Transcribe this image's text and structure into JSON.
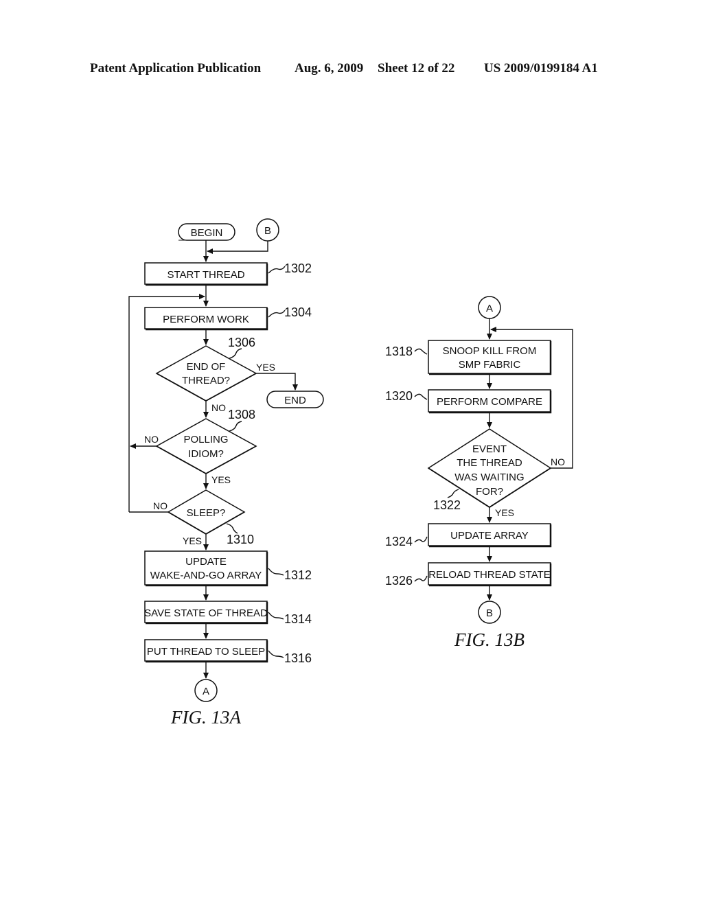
{
  "header": {
    "publication": "Patent Application Publication",
    "date": "Aug. 6, 2009",
    "sheet": "Sheet 12 of 22",
    "number": "US 2009/0199184 A1"
  },
  "fig13a": {
    "caption": "FIG. 13A",
    "begin": "BEGIN",
    "connector_in": "B",
    "connector_out": "A",
    "end": "END",
    "start_thread": {
      "text": "START THREAD",
      "ref": "1302"
    },
    "perform_work": {
      "text": "PERFORM WORK",
      "ref": "1304"
    },
    "end_of_thread": {
      "line1": "END OF",
      "line2": "THREAD?",
      "ref": "1306",
      "yes": "YES",
      "no": "NO"
    },
    "polling_idiom": {
      "line1": "POLLING",
      "line2": "IDIOM?",
      "ref": "1308",
      "yes": "YES",
      "no": "NO"
    },
    "sleep": {
      "text": "SLEEP?",
      "ref": "1310",
      "yes": "YES",
      "no": "NO"
    },
    "update_array": {
      "line1": "UPDATE",
      "line2": "WAKE-AND-GO ARRAY",
      "ref": "1312"
    },
    "save_state": {
      "text": "SAVE STATE OF THREAD",
      "ref": "1314"
    },
    "put_sleep": {
      "text": "PUT THREAD TO SLEEP",
      "ref": "1316"
    }
  },
  "fig13b": {
    "caption": "FIG. 13B",
    "connector_in": "A",
    "connector_out": "B",
    "snoop_kill": {
      "line1": "SNOOP KILL FROM",
      "line2": "SMP FABRIC",
      "ref": "1318"
    },
    "perform_compare": {
      "text": "PERFORM COMPARE",
      "ref": "1320"
    },
    "event_decision": {
      "line1": "EVENT",
      "line2": "THE THREAD",
      "line3": "WAS WAITING",
      "line4": "FOR?",
      "ref": "1322",
      "yes": "YES",
      "no": "NO"
    },
    "update_array": {
      "text": "UPDATE ARRAY",
      "ref": "1324"
    },
    "reload_state": {
      "text": "RELOAD THREAD STATE",
      "ref": "1326"
    }
  }
}
